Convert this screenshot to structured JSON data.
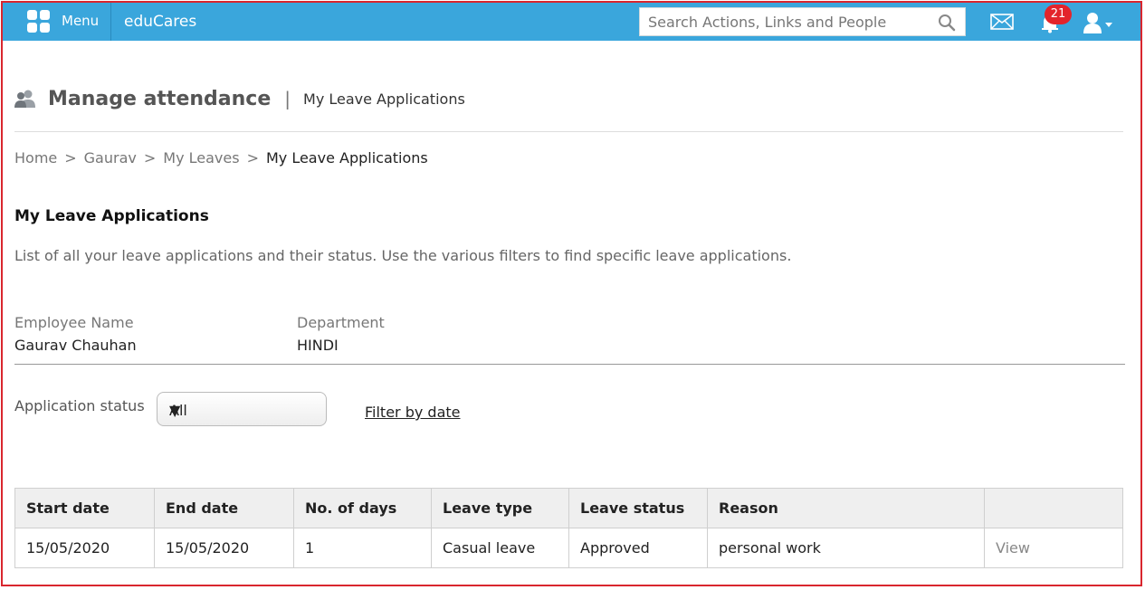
{
  "topbar": {
    "menu_label": "Menu",
    "brand": "eduCares",
    "search_placeholder": "Search Actions, Links and People",
    "notification_count": "21",
    "color": "#3aa6dc"
  },
  "header": {
    "title": "Manage attendance",
    "separator": "|",
    "subtitle": "My Leave Applications"
  },
  "breadcrumb": {
    "items": [
      "Home",
      "Gaurav",
      "My Leaves"
    ],
    "current": "My Leave Applications",
    "separator": ">"
  },
  "section": {
    "title": "My Leave Applications",
    "description": "List of all your leave applications and their status. Use the various filters to find specific leave applications."
  },
  "employee": {
    "name_label": "Employee Name",
    "name_value": "Gaurav Chauhan",
    "department_label": "Department",
    "department_value": "HINDI"
  },
  "filters": {
    "status_label": "Application status",
    "status_selected": "All",
    "filter_by_date": "Filter by date"
  },
  "table": {
    "headers": [
      "Start date",
      "End date",
      "No. of days",
      "Leave type",
      "Leave status",
      "Reason",
      ""
    ],
    "rows": [
      [
        "15/05/2020",
        "15/05/2020",
        "1",
        "Casual leave",
        "Approved",
        "personal work",
        "View"
      ]
    ]
  }
}
